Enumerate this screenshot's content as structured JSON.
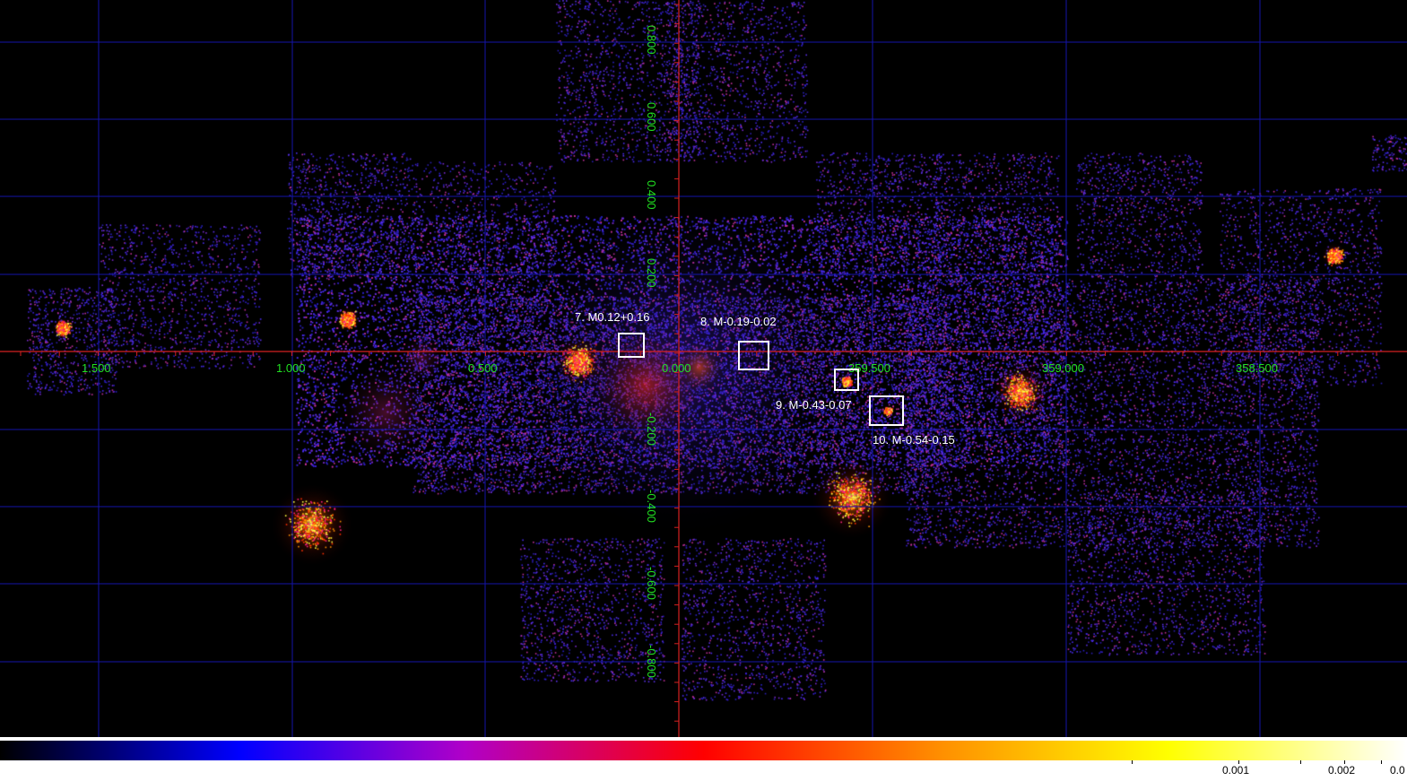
{
  "colors": {
    "grid_line": "#1414a8",
    "axis_line": "#d42020",
    "axis_labels": "#21e021",
    "region_boxes": "#ffffff",
    "colormap": [
      "#000000",
      "#0000ff",
      "#b000c8",
      "#ff0000",
      "#ff9000",
      "#ffff00",
      "#ffffff"
    ]
  },
  "longitude_labels": [
    "1.500",
    "1.000",
    "0.500",
    "0.000",
    "359.500",
    "359.000",
    "358.500"
  ],
  "latitude_labels": [
    "0.800",
    "0.600",
    "0.400",
    "0.200",
    "-0.200",
    "-0.400",
    "-0.600",
    "-0.800"
  ],
  "regions": [
    {
      "label": "7. M0.12+0.16"
    },
    {
      "label": "8. M-0.19-0.02"
    },
    {
      "label": "9. M-0.43-0.07"
    },
    {
      "label": "10. M-0.54-0.15"
    }
  ],
  "colorbar": {
    "tick_labels": [
      "0.001",
      "0.002",
      "0.0"
    ]
  }
}
